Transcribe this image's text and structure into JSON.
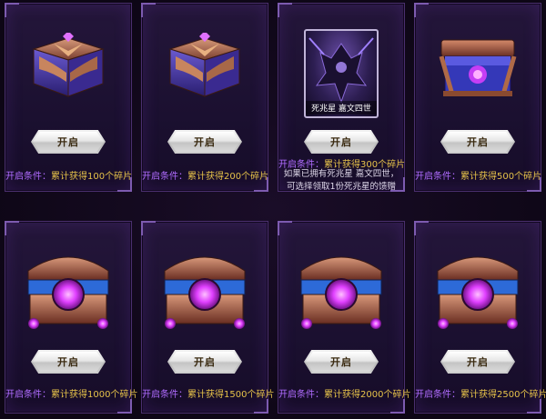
{
  "cards": [
    {
      "button": "开启",
      "cond_label": "开启条件：",
      "cond_value": "累计获得100个碎片",
      "kind": "chest-small"
    },
    {
      "button": "开启",
      "cond_label": "开启条件：",
      "cond_value": "累计获得200个碎片",
      "kind": "chest-small"
    },
    {
      "button": "开启",
      "cond_label": "开启条件：",
      "cond_value": "累计获得300个碎片",
      "kind": "portrait",
      "portrait_name": "死兆星 嘉文四世",
      "note_line1": "如果已拥有死兆星 嘉文四世，",
      "note_line2": "可选择领取1份死兆星的馈赠"
    },
    {
      "button": "开启",
      "cond_label": "开启条件：",
      "cond_value": "累计获得500个碎片",
      "kind": "chest-blue"
    },
    {
      "button": "开启",
      "cond_label": "开启条件：",
      "cond_value": "累计获得1000个碎片",
      "kind": "chest-orb"
    },
    {
      "button": "开启",
      "cond_label": "开启条件：",
      "cond_value": "累计获得1500个碎片",
      "kind": "chest-orb"
    },
    {
      "button": "开启",
      "cond_label": "开启条件：",
      "cond_value": "累计获得2000个碎片",
      "kind": "chest-orb"
    },
    {
      "button": "开启",
      "cond_label": "开启条件：",
      "cond_value": "累计获得2500个碎片",
      "kind": "chest-orb"
    }
  ],
  "colors": {
    "condition_label": "#b06cff",
    "condition_value": "#e6c24a",
    "panel_border": "#4a2f6e",
    "gem_magenta": "#e040ff"
  }
}
